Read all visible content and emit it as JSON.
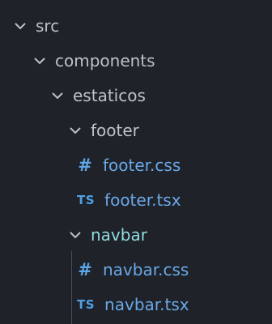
{
  "explorer": {
    "items": [
      {
        "label": "src",
        "kind": "folder",
        "icon": "chevron-down-icon"
      },
      {
        "label": "components",
        "kind": "folder",
        "icon": "chevron-down-icon"
      },
      {
        "label": "estaticos",
        "kind": "folder",
        "icon": "chevron-down-icon"
      },
      {
        "label": "footer",
        "kind": "folder",
        "icon": "chevron-down-icon"
      },
      {
        "label": "footer.css",
        "kind": "file",
        "icon": "css-file-icon",
        "badge": "#"
      },
      {
        "label": "footer.tsx",
        "kind": "file",
        "icon": "tsx-file-icon",
        "badge": "TS"
      },
      {
        "label": "navbar",
        "kind": "folder",
        "icon": "chevron-down-icon"
      },
      {
        "label": "navbar.css",
        "kind": "file",
        "icon": "css-file-icon",
        "badge": "#"
      },
      {
        "label": "navbar.tsx",
        "kind": "file",
        "icon": "tsx-file-icon",
        "badge": "TS"
      }
    ]
  },
  "colors": {
    "background": "#1f2228",
    "text": "#bdc2c8",
    "file_text": "#6aa8e8",
    "active_folder_text": "#8fdce1",
    "icon_blue": "#5da6e8"
  }
}
